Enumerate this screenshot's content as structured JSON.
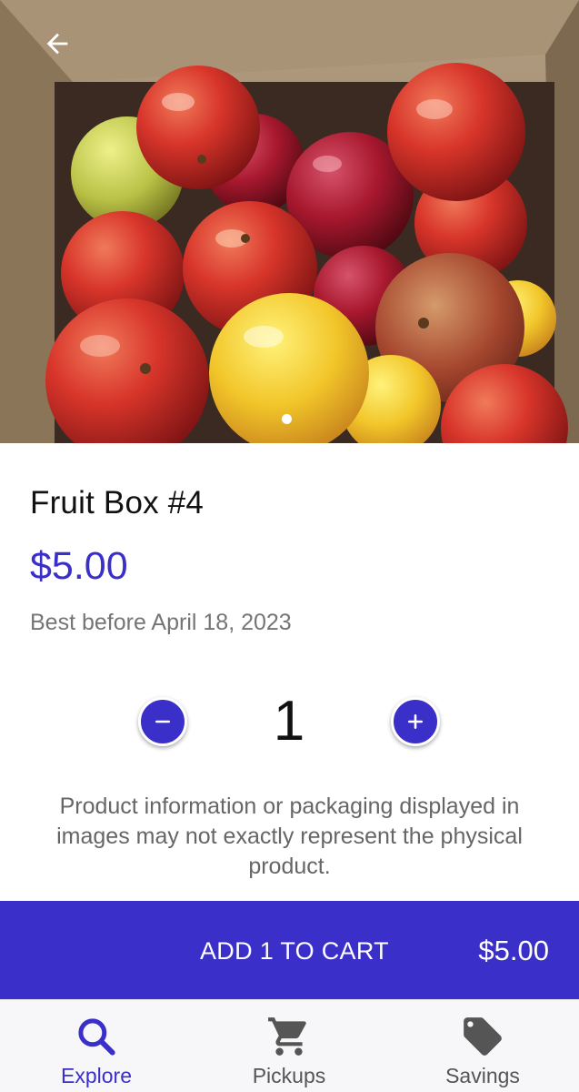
{
  "product": {
    "title": "Fruit Box #4",
    "price": "$5.00",
    "best_before": "Best before April 18, 2023",
    "image_alt": "Box of apples",
    "carousel_active_index": 1,
    "carousel_total": 1
  },
  "quantity": {
    "value": "1",
    "minus_icon": "minus-icon",
    "plus_icon": "plus-icon"
  },
  "disclaimer": "Product information or packaging displayed in images may not exactly represent the physical product.",
  "cart": {
    "label": "ADD 1 TO CART",
    "total": "$5.00"
  },
  "nav": {
    "items": [
      {
        "label": "Explore",
        "icon": "search-icon",
        "active": true
      },
      {
        "label": "Pickups",
        "icon": "cart-icon",
        "active": false
      },
      {
        "label": "Savings",
        "icon": "tag-icon",
        "active": false
      }
    ]
  },
  "colors": {
    "accent": "#3b2fc9",
    "nav_background": "#f7f6f8"
  }
}
